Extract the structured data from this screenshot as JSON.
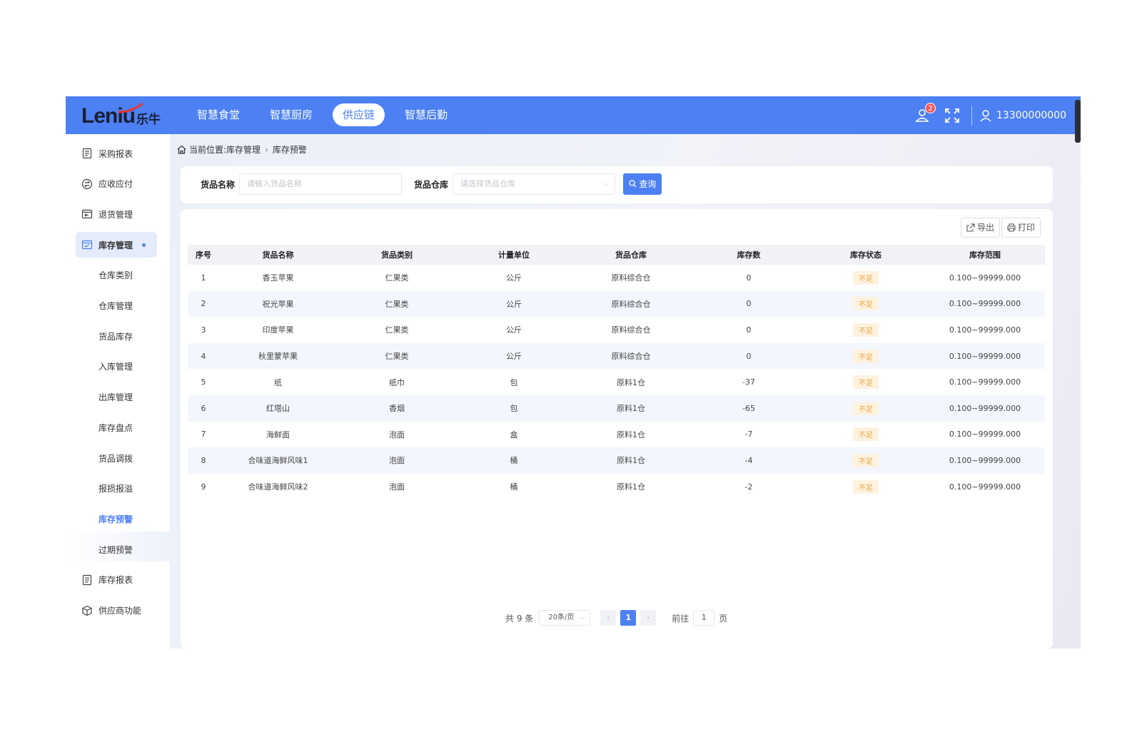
{
  "brand": {
    "logo_en": "Leniu",
    "logo_cn": "乐牛"
  },
  "nav": [
    {
      "label": "智慧食堂"
    },
    {
      "label": "智慧厨房"
    },
    {
      "label": "供应链",
      "active": true
    },
    {
      "label": "智慧后勤"
    }
  ],
  "header": {
    "notification_count": "2",
    "username": "13300000000",
    "icons": [
      "notification-icon",
      "fullscreen-icon",
      "user-icon"
    ]
  },
  "sidebar": {
    "top_items": [
      {
        "label": "采购报表",
        "icon": "report-icon"
      },
      {
        "label": "应收应付",
        "icon": "payment-icon"
      },
      {
        "label": "退货管理",
        "icon": "return-icon"
      },
      {
        "label": "库存管理",
        "icon": "inventory-icon",
        "active": true
      }
    ],
    "sub_items": [
      {
        "label": "仓库类别"
      },
      {
        "label": "仓库管理"
      },
      {
        "label": "货品库存"
      },
      {
        "label": "入库管理"
      },
      {
        "label": "出库管理"
      },
      {
        "label": "库存盘点"
      },
      {
        "label": "货品调拨"
      },
      {
        "label": "报损报溢"
      },
      {
        "label": "库存预警",
        "current": true
      },
      {
        "label": "过期预警"
      }
    ],
    "bottom_items": [
      {
        "label": "库存报表",
        "icon": "report-icon"
      },
      {
        "label": "供应商功能",
        "icon": "cube-icon"
      }
    ]
  },
  "breadcrumb": {
    "prefix": "当前位置:",
    "level1": "库存管理",
    "level2": "库存预警"
  },
  "search": {
    "name_label": "货品名称",
    "name_placeholder": "请输入货品名称",
    "warehouse_label": "货品仓库",
    "warehouse_placeholder": "请选择货品仓库",
    "query_label": "查询"
  },
  "toolbar": {
    "export_label": "导出",
    "print_label": "打印"
  },
  "table": {
    "columns": [
      "序号",
      "货品名称",
      "货品类别",
      "计量单位",
      "货品仓库",
      "库存数",
      "库存状态",
      "库存范围"
    ],
    "rows": [
      [
        "1",
        "香玉苹果",
        "仁果类",
        "公斤",
        "原料综合仓",
        "0",
        "不足",
        "0.100~99999.000"
      ],
      [
        "2",
        "祝光苹果",
        "仁果类",
        "公斤",
        "原料综合仓",
        "0",
        "不足",
        "0.100~99999.000"
      ],
      [
        "3",
        "印度苹果",
        "仁果类",
        "公斤",
        "原料综合仓",
        "0",
        "不足",
        "0.100~99999.000"
      ],
      [
        "4",
        "秋里蒙苹果",
        "仁果类",
        "公斤",
        "原料综合仓",
        "0",
        "不足",
        "0.100~99999.000"
      ],
      [
        "5",
        "纸",
        "纸巾",
        "包",
        "原料1仓",
        "-37",
        "不足",
        "0.100~99999.000"
      ],
      [
        "6",
        "红塔山",
        "香烟",
        "包",
        "原料1仓",
        "-65",
        "不足",
        "0.100~99999.000"
      ],
      [
        "7",
        "海鲜面",
        "泡面",
        "盒",
        "原料1仓",
        "-7",
        "不足",
        "0.100~99999.000"
      ],
      [
        "8",
        "合味道海鲜风味1",
        "泡面",
        "桶",
        "原料1仓",
        "-4",
        "不足",
        "0.100~99999.000"
      ],
      [
        "9",
        "合味道海鲜风味2",
        "泡面",
        "桶",
        "原料1仓",
        "-2",
        "不足",
        "0.100~99999.000"
      ]
    ]
  },
  "pagination": {
    "total_text": "共 9 条",
    "page_size": "20条/页",
    "current_page": "1",
    "goto_label": "前往",
    "goto_value": "1",
    "page_suffix": "页"
  },
  "colors": {
    "primary": "#4d80f3",
    "warning_bg": "#fdf2df",
    "warning_text": "#f0a43a"
  }
}
